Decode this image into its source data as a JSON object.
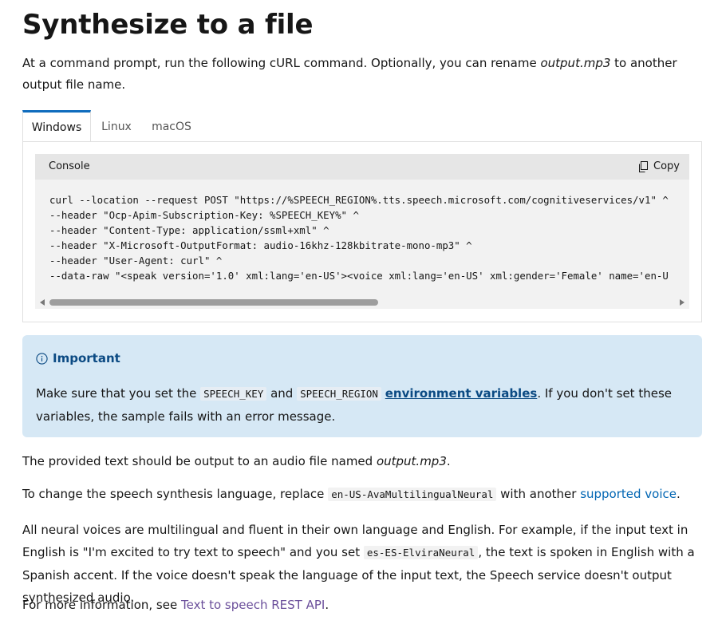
{
  "title": "Synthesize to a file",
  "intro": {
    "before": "At a command prompt, run the following cURL command. Optionally, you can rename ",
    "em": "output.mp3",
    "after": " to another output file name."
  },
  "tabs": [
    "Windows",
    "Linux",
    "macOS"
  ],
  "active_tab": "Windows",
  "code": {
    "language": "Console",
    "copy_label": "Copy",
    "lines": [
      "curl --location --request POST \"https://%SPEECH_REGION%.tts.speech.microsoft.com/cognitiveservices/v1\" ^",
      "--header \"Ocp-Apim-Subscription-Key: %SPEECH_KEY%\" ^",
      "--header \"Content-Type: application/ssml+xml\" ^",
      "--header \"X-Microsoft-OutputFormat: audio-16khz-128kbitrate-mono-mp3\" ^",
      "--header \"User-Agent: curl\" ^",
      "--data-raw \"<speak version='1.0' xml:lang='en-US'><voice xml:lang='en-US' xml:gender='Female' name='en-U"
    ]
  },
  "important": {
    "title": "Important",
    "t1": "Make sure that you set the ",
    "code1": "SPEECH_KEY",
    "t2": " and ",
    "code2": "SPEECH_REGION",
    "link": "environment variables",
    "t3": ". If you don't set these variables, the sample fails with an error message."
  },
  "p2": {
    "before": "The provided text should be output to an audio file named ",
    "em": "output.mp3",
    "after": "."
  },
  "p3": {
    "before": "To change the speech synthesis language, replace ",
    "code": "en-US-AvaMultilingualNeural",
    "mid": " with another ",
    "link": "supported voice",
    "after": "."
  },
  "p4": {
    "before": "All neural voices are multilingual and fluent in their own language and English. For example, if the input text in English is \"I'm excited to try text to speech\" and you set ",
    "code": "es-ES-ElviraNeural",
    "after": ", the text is spoken in English with a Spanish accent. If the voice doesn't speak the language of the input text, the Speech service doesn't output synthesized audio."
  },
  "p5": {
    "before": "For more information, see ",
    "link": "Text to speech REST API",
    "after": "."
  }
}
